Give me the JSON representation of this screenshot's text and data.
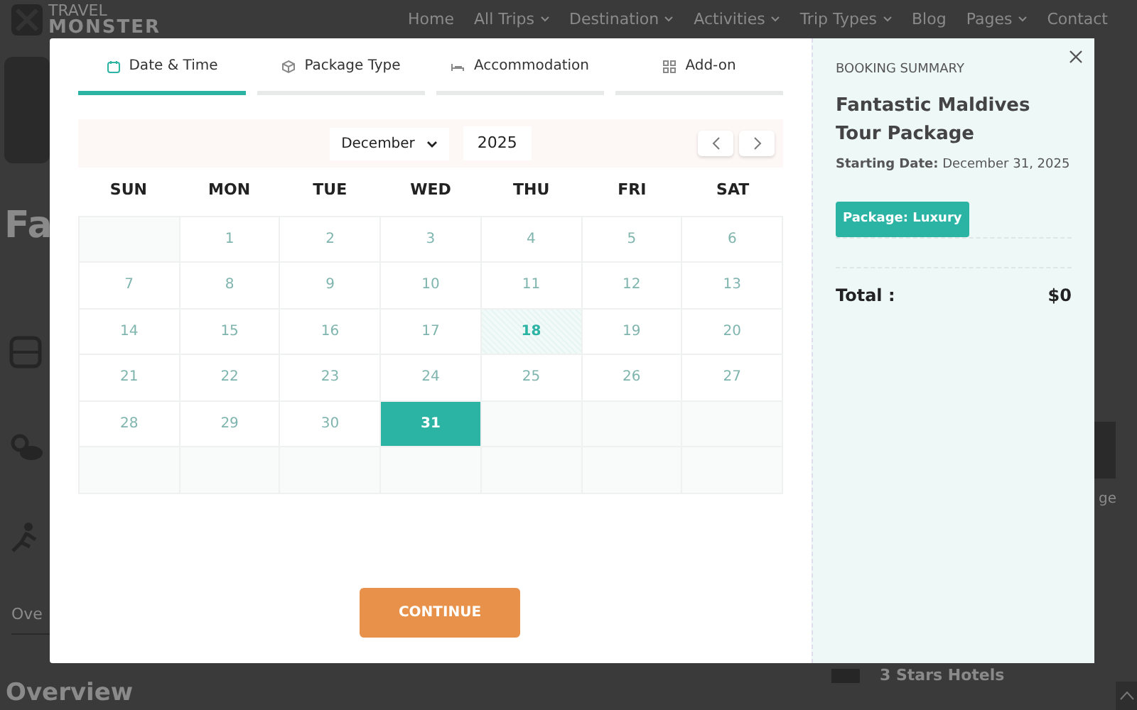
{
  "background_page": {
    "logo": {
      "line_1": "TRAVEL",
      "line_2": "MONSTER"
    },
    "nav": [
      {
        "label": "Home",
        "caret": false
      },
      {
        "label": "All Trips",
        "caret": true
      },
      {
        "label": "Destination",
        "caret": true
      },
      {
        "label": "Activities",
        "caret": true
      },
      {
        "label": "Trip Types",
        "caret": true
      },
      {
        "label": "Blog",
        "caret": false
      },
      {
        "label": "Pages",
        "caret": true
      },
      {
        "label": "Contact",
        "caret": false
      }
    ],
    "heading": "Fa",
    "tab": "Ove",
    "section_heading": "Overview",
    "side_text": "ge",
    "hotel_text": "3 Stars Hotels"
  },
  "modal": {
    "steps": [
      {
        "label": "Date & Time",
        "selected": true
      },
      {
        "label": "Package Type",
        "selected": false
      },
      {
        "label": "Accommodation",
        "selected": false
      },
      {
        "label": "Add-on",
        "selected": false
      }
    ],
    "calendar": {
      "month": "December",
      "year": "2025",
      "weekdays": [
        "SUN",
        "MON",
        "TUE",
        "WED",
        "THU",
        "FRI",
        "SAT"
      ],
      "weeks": [
        [
          {
            "kind": "empty"
          },
          {
            "kind": "disabled",
            "day": "1",
            "selected": false
          },
          {
            "kind": "disabled",
            "day": "2",
            "selected": false
          },
          {
            "kind": "disabled",
            "day": "3",
            "selected": false
          },
          {
            "kind": "disabled",
            "day": "4",
            "selected": false
          },
          {
            "kind": "disabled",
            "day": "5",
            "selected": false
          },
          {
            "kind": "disabled",
            "day": "6",
            "selected": false
          }
        ],
        [
          {
            "kind": "disabled",
            "day": "7",
            "selected": false
          },
          {
            "kind": "disabled",
            "day": "8",
            "selected": false
          },
          {
            "kind": "disabled",
            "day": "9",
            "selected": false
          },
          {
            "kind": "disabled",
            "day": "10",
            "selected": false
          },
          {
            "kind": "disabled",
            "day": "11",
            "selected": false
          },
          {
            "kind": "disabled",
            "day": "12",
            "selected": false
          },
          {
            "kind": "disabled",
            "day": "13",
            "selected": false
          }
        ],
        [
          {
            "kind": "disabled",
            "day": "14",
            "selected": false
          },
          {
            "kind": "disabled",
            "day": "15",
            "selected": false
          },
          {
            "kind": "disabled",
            "day": "16",
            "selected": false
          },
          {
            "kind": "disabled",
            "day": "17",
            "selected": false
          },
          {
            "kind": "today",
            "day": "18",
            "selected": false
          },
          {
            "kind": "disabled",
            "day": "19",
            "selected": false
          },
          {
            "kind": "disabled",
            "day": "20",
            "selected": false
          }
        ],
        [
          {
            "kind": "disabled",
            "day": "21",
            "selected": false
          },
          {
            "kind": "disabled",
            "day": "22",
            "selected": false
          },
          {
            "kind": "disabled",
            "day": "23",
            "selected": false
          },
          {
            "kind": "disabled",
            "day": "24",
            "selected": false
          },
          {
            "kind": "disabled",
            "day": "25",
            "selected": false
          },
          {
            "kind": "disabled",
            "day": "26",
            "selected": false
          },
          {
            "kind": "disabled",
            "day": "27",
            "selected": false
          }
        ],
        [
          {
            "kind": "disabled",
            "day": "28",
            "selected": false
          },
          {
            "kind": "disabled",
            "day": "29",
            "selected": false
          },
          {
            "kind": "disabled",
            "day": "30",
            "selected": false
          },
          {
            "kind": "available",
            "day": "31",
            "selected": true
          },
          {
            "kind": "empty"
          },
          {
            "kind": "empty"
          },
          {
            "kind": "empty"
          }
        ],
        [
          {
            "kind": "empty"
          },
          {
            "kind": "empty"
          },
          {
            "kind": "empty"
          },
          {
            "kind": "empty"
          },
          {
            "kind": "empty"
          },
          {
            "kind": "empty"
          },
          {
            "kind": "empty"
          }
        ]
      ]
    },
    "continue_button": "CONTINUE",
    "summary": {
      "heading": "BOOKING SUMMARY",
      "trip_title": "Fantastic Maldives Tour Package",
      "date_label": "Starting Date:",
      "date_value": "December 31, 2025",
      "package_tag": "Package: Luxury",
      "total_label": "Total :",
      "total_value": "$0"
    }
  }
}
